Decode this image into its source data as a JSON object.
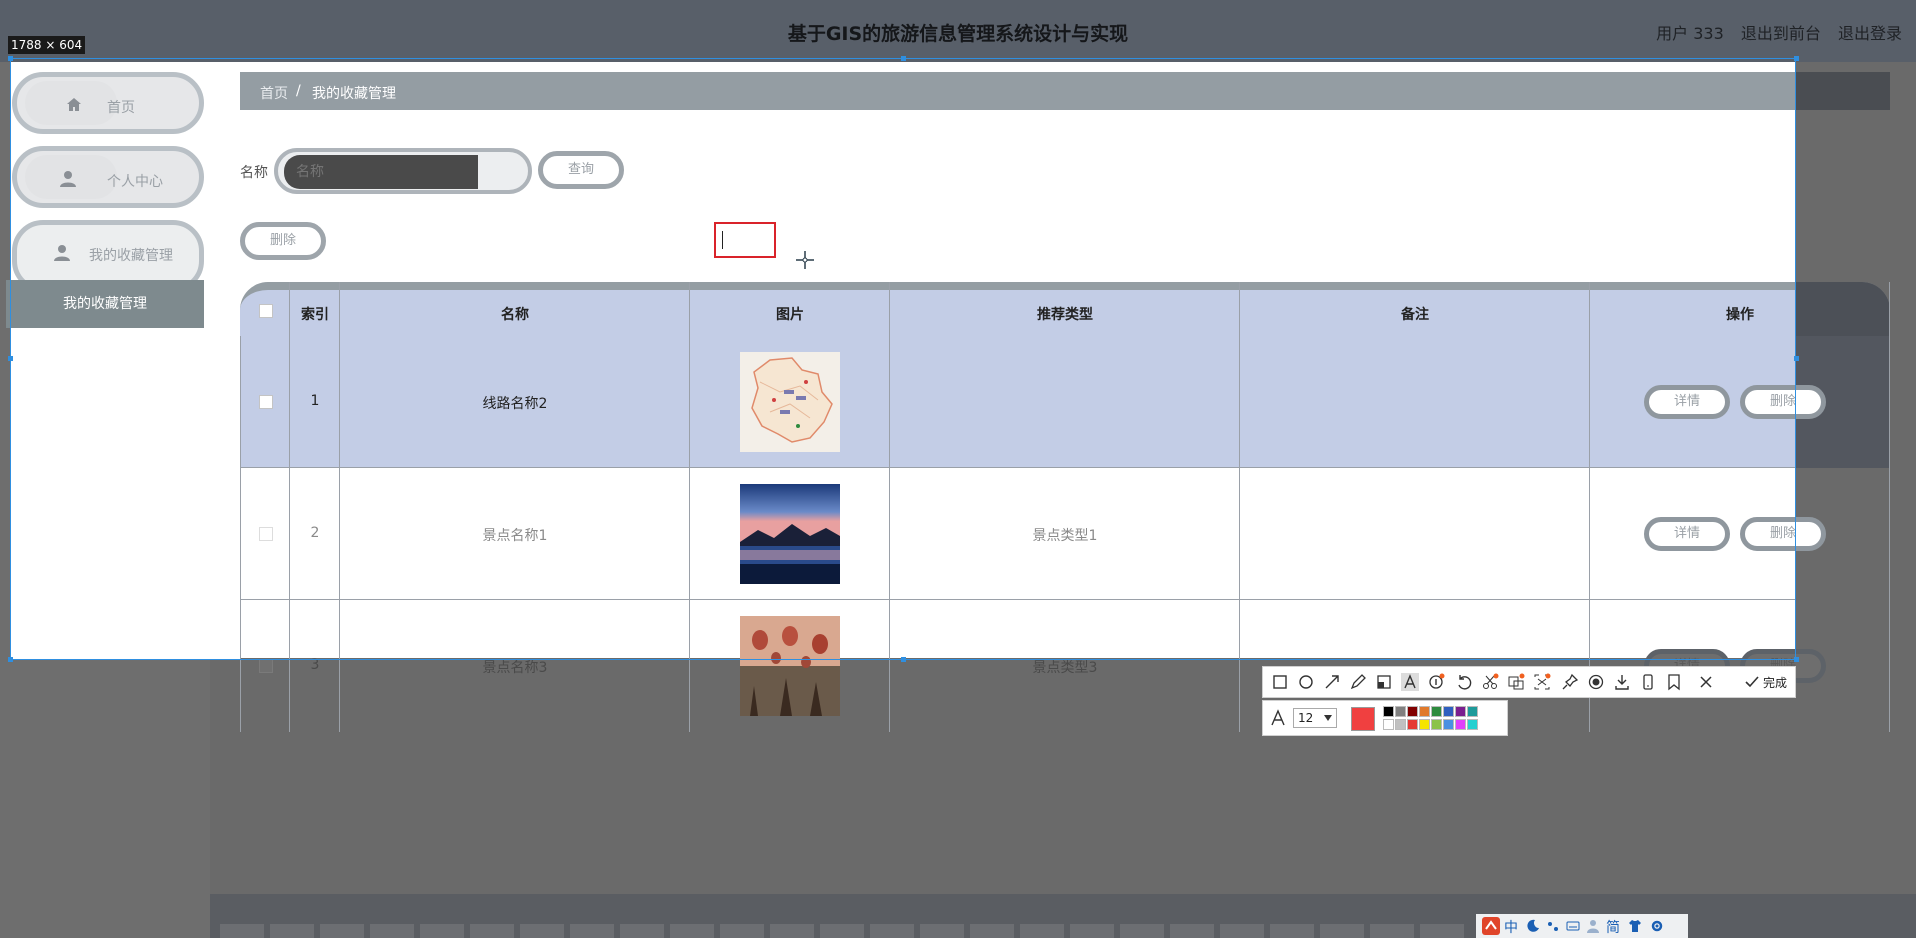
{
  "header": {
    "title": "基于GIS的旅游信息管理系统设计与实现",
    "user": "用户 333",
    "to_front": "退出到前台",
    "logout": "退出登录"
  },
  "sidebar": {
    "items": [
      {
        "label": "首页",
        "icon": "home-icon"
      },
      {
        "label": "个人中心",
        "icon": "user-icon"
      },
      {
        "label": "我的收藏管理",
        "icon": "user-icon"
      }
    ],
    "submenu": "我的收藏管理"
  },
  "breadcrumb": {
    "home": "首页",
    "separator": "/",
    "current": "我的收藏管理"
  },
  "search": {
    "label": "名称",
    "placeholder": "名称",
    "button": "查询"
  },
  "actions": {
    "delete": "删除"
  },
  "table": {
    "headers": [
      "索引",
      "名称",
      "图片",
      "推荐类型",
      "备注",
      "操作"
    ],
    "rows": [
      {
        "index": "1",
        "name": "线路名称2",
        "type": "",
        "note": "",
        "image": "map"
      },
      {
        "index": "2",
        "name": "景点名称1",
        "type": "景点类型1",
        "note": "",
        "image": "lake"
      },
      {
        "index": "3",
        "name": "景点名称3",
        "type": "景点类型3",
        "note": "",
        "image": "balloons"
      }
    ],
    "detail_label": "详情",
    "delete_label": "删除"
  },
  "capture": {
    "size_label": "1788 × 604",
    "font_size": "12",
    "done": "完成",
    "current_color": "#f04040",
    "colors_top": [
      "#000000",
      "#808080",
      "#800000",
      "#e07a2c",
      "#2e8b3e",
      "#2f5fbf",
      "#7b1f8f",
      "#1f9a9a"
    ],
    "colors_bottom": [
      "#ffffff",
      "#c0c0c0",
      "#e53935",
      "#f5e500",
      "#8bc34a",
      "#4a90e2",
      "#e040fb",
      "#26d0d0"
    ]
  },
  "ime": {
    "lang": "中",
    "mode": "简"
  },
  "colors": {
    "accent": "#c3cde6",
    "header_bg": "#585f69",
    "selection": "#2f8fe0"
  }
}
